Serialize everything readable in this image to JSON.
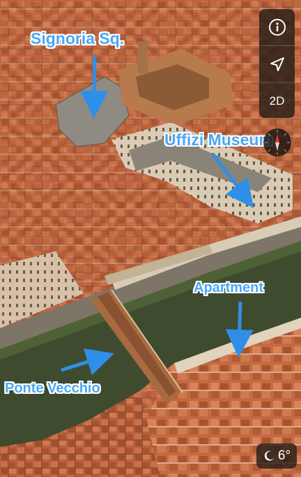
{
  "labels": {
    "signoria": "Signoria Sq.",
    "uffizi": "Uffizi Museum",
    "apartment": "Apartment",
    "ponte": "Ponte Vecchio"
  },
  "controls": {
    "info_icon": "info-icon",
    "location_icon": "location-arrow-icon",
    "view_mode": "2D"
  },
  "weather": {
    "icon": "moon-icon",
    "temperature": "6°"
  },
  "colors": {
    "label_blue": "#4aa8f5",
    "arrow_blue": "#2f8fe8",
    "roof": "#c0643c",
    "river": "#3d4a2c"
  }
}
